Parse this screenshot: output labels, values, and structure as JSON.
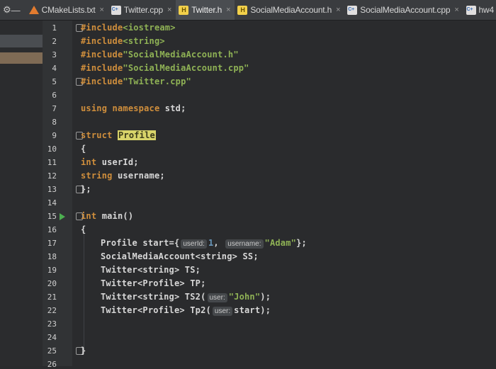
{
  "tabs": [
    {
      "label": "CMakeLists.txt",
      "icon": "cmake-icon",
      "active": false
    },
    {
      "label": "Twitter.cpp",
      "icon": "cpp-file-icon",
      "active": false
    },
    {
      "label": "Twitter.h",
      "icon": "header-file-icon",
      "active": true
    },
    {
      "label": "SocialMediaAccount.h",
      "icon": "header-file-icon",
      "active": false
    },
    {
      "label": "SocialMediaAccount.cpp",
      "icon": "cpp-file-icon",
      "active": false
    },
    {
      "label": "hw4",
      "icon": "cpp-file-icon",
      "active": false
    }
  ],
  "controls": {
    "settings": "⚙",
    "minimize": "—",
    "close": "×"
  },
  "line_numbers": [
    "1",
    "2",
    "3",
    "4",
    "5",
    "6",
    "7",
    "8",
    "9",
    "10",
    "11",
    "12",
    "13",
    "14",
    "15",
    "16",
    "17",
    "18",
    "19",
    "20",
    "21",
    "22",
    "23",
    "24",
    "25",
    "26"
  ],
  "code": {
    "l1a": "#include",
    "l1b": "<iostream>",
    "l2a": "#include",
    "l2b": "<string>",
    "l3a": "#include",
    "l3b": "\"SocialMediaAccount.h\"",
    "l4a": "#include",
    "l4b": "\"SocialMediaAccount.cpp\"",
    "l5a": "#include",
    "l5b": "\"Twitter.cpp\"",
    "l7a": "using namespace",
    "l7b": " std;",
    "l9a": "struct ",
    "l9b": "Profile",
    "l10": "{",
    "l11a": "int",
    "l11b": " userId;",
    "l12a": "string",
    "l12b": " username;",
    "l13": "};",
    "l15a": "int",
    "l15b": " main()",
    "l16": "{",
    "l17a": "Profile start={",
    "l17h1": "userId:",
    "l17n": "1",
    "l17c": ",",
    "l17h2": "username:",
    "l17s": "\"Adam\"",
    "l17e": "};",
    "l18a": "SocialMediaAccount<string> SS;",
    "l19a": "Twitter<string> TS;",
    "l20a": "Twitter<Profile> TP;",
    "l21a": "Twitter<string> TS2(",
    "l21h": "user:",
    "l21s": "\"John\"",
    "l21e": ");",
    "l22a": "Twitter<Profile> Tp2(",
    "l22h": "user:",
    "l22b": "start);",
    "l25": "}"
  }
}
